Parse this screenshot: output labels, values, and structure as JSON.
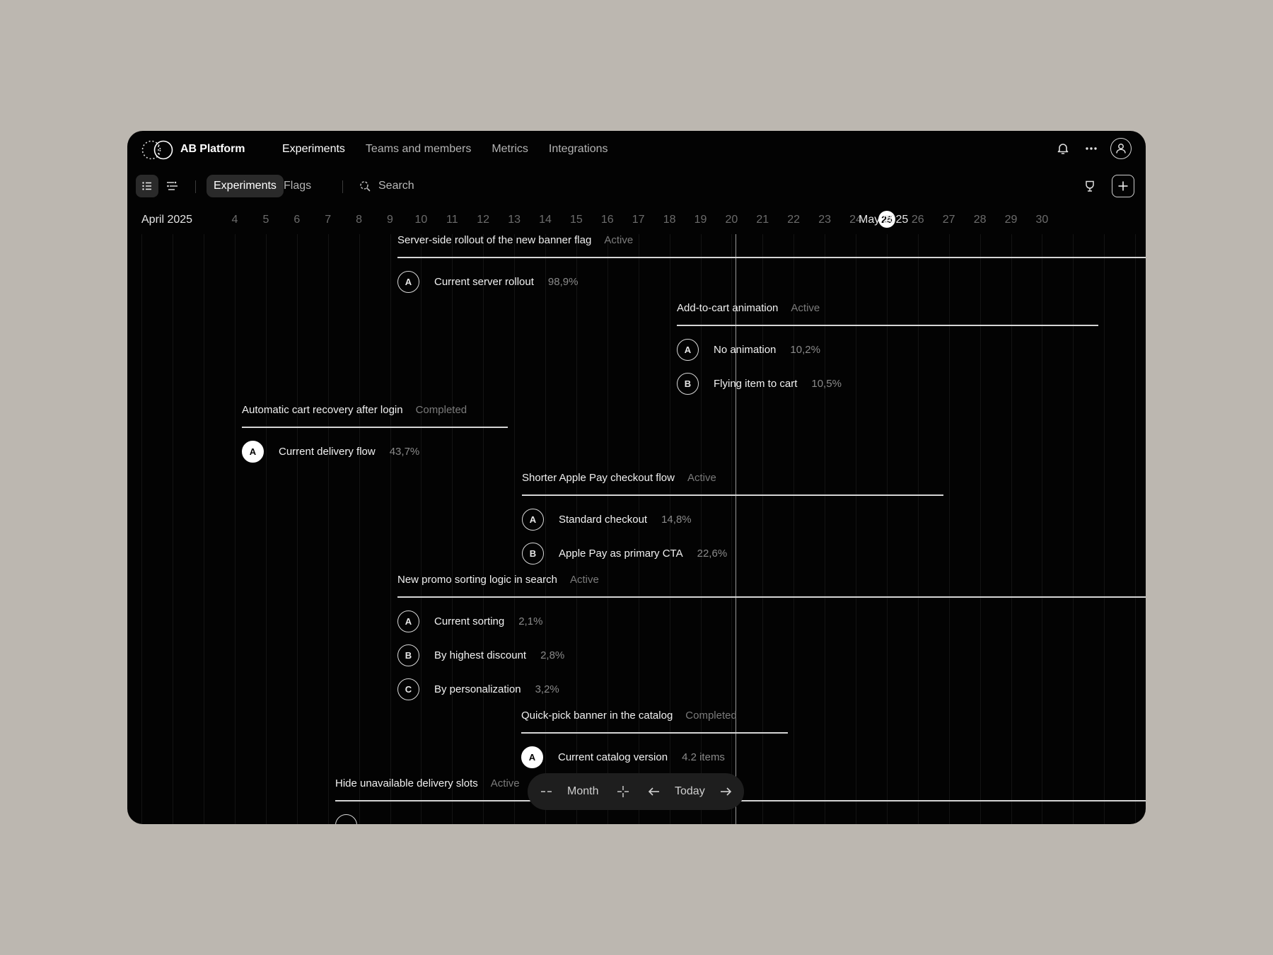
{
  "app": {
    "brand": "AB Platform"
  },
  "nav": [
    {
      "label": "Experiments",
      "active": true
    },
    {
      "label": "Teams and members",
      "active": false
    },
    {
      "label": "Metrics",
      "active": false
    },
    {
      "label": "Integrations",
      "active": false
    }
  ],
  "toolbar": {
    "segments": [
      {
        "label": "Experiments",
        "active": true
      },
      {
        "label": "Flags",
        "active": false
      }
    ],
    "search_label": "Search"
  },
  "timeline": {
    "start_month": "April 2025",
    "end_month": "May 2025",
    "days": [
      "4",
      "5",
      "6",
      "7",
      "8",
      "9",
      "10",
      "11",
      "12",
      "13",
      "14",
      "15",
      "16",
      "17",
      "18",
      "19",
      "20",
      "21",
      "22",
      "23",
      "24",
      "25",
      "26",
      "27",
      "28",
      "29",
      "30"
    ],
    "today": "25"
  },
  "experiments": [
    {
      "title": "Server-side rollout of the new banner flag",
      "status": "Active",
      "variants": [
        {
          "letter": "A",
          "name": "Current server rollout",
          "value": "98,9%"
        }
      ]
    },
    {
      "title": "Add-to-cart animation",
      "status": "Active",
      "variants": [
        {
          "letter": "A",
          "name": "No animation",
          "value": "10,2%"
        },
        {
          "letter": "B",
          "name": "Flying item to cart",
          "value": "10,5%"
        }
      ]
    },
    {
      "title": "Automatic cart recovery after login",
      "status": "Completed",
      "variants": [
        {
          "letter": "A",
          "name": "Current delivery flow",
          "value": "43,7%"
        }
      ]
    },
    {
      "title": "Shorter Apple Pay checkout flow",
      "status": "Active",
      "variants": [
        {
          "letter": "A",
          "name": "Standard checkout",
          "value": "14,8%"
        },
        {
          "letter": "B",
          "name": "Apple Pay as primary CTA",
          "value": "22,6%"
        }
      ]
    },
    {
      "title": "New promo sorting logic in search",
      "status": "Active",
      "variants": [
        {
          "letter": "A",
          "name": "Current sorting",
          "value": "2,1%"
        },
        {
          "letter": "B",
          "name": "By highest discount",
          "value": "2,8%"
        },
        {
          "letter": "C",
          "name": "By personalization",
          "value": "3,2%"
        }
      ]
    },
    {
      "title": "Quick-pick banner in the catalog",
      "status": "Completed",
      "variants": [
        {
          "letter": "A",
          "name": "Current catalog version",
          "value": "4.2 items"
        }
      ]
    },
    {
      "title": "Hide unavailable delivery slots",
      "status": "Active",
      "variants": []
    }
  ],
  "controls": {
    "zoom_label": "Month",
    "today_label": "Today"
  }
}
